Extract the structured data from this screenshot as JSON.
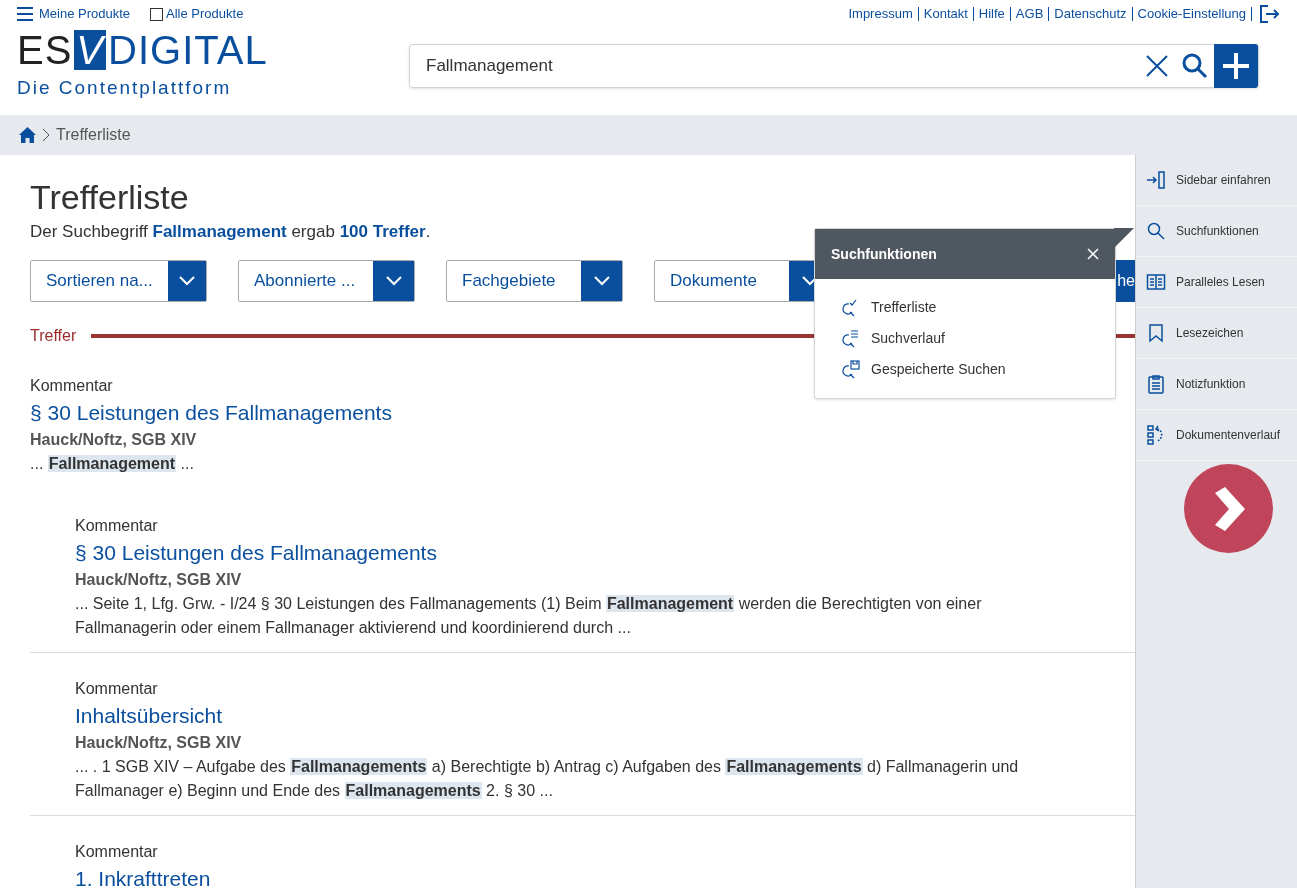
{
  "topbar": {
    "menu_label": "Meine Produkte",
    "all_products": {
      "label": "Alle Produkte",
      "checked": false
    },
    "links": [
      "Impressum",
      "Kontakt",
      "Hilfe",
      "AGB",
      "Datenschutz",
      "Cookie-Einstellung"
    ]
  },
  "logo": {
    "left": "ES",
    "mark": "V",
    "right": "DIGITAL",
    "tagline": "Die Contentplattform"
  },
  "search": {
    "value": "Fallmanagement"
  },
  "breadcrumb": [
    "Trefferliste"
  ],
  "page_title": "Trefferliste",
  "summary": "Der Suchbegriff **Fallmanagement** ergab **100 Treffer**.",
  "filters": [
    "Sortieren na...",
    "Abonnierte ...",
    "Fachgebiete",
    "Dokumente"
  ],
  "hidden_button": "he",
  "section_label": "Treffer",
  "results": [
    {
      "type": "Kommentar",
      "title": "§ 30 Leistungen des Fallmanagements",
      "author": "Hauck/Noftz, SGB XIV",
      "excerpt": "... **Fallmanagement** ...",
      "children": [
        {
          "type": "Kommentar",
          "title": "§ 30 Leistungen des Fallmanagements",
          "author": "Hauck/Noftz, SGB XIV",
          "excerpt": "... Seite 1, Lfg. Grw. - I/24 § 30 Leistungen des Fallmanagements (1) Beim **Fallmanagement** werden die Berechtigten von einer Fallmanagerin oder einem Fallmanager aktivierend und koordinierend durch ..."
        },
        {
          "type": "Kommentar",
          "title": "Inhaltsübersicht",
          "author": "Hauck/Noftz, SGB XIV",
          "excerpt": "... . 1 SGB XIV – Aufgabe des **Fallmanagements** a) Berechtigte b) Antrag c) Aufgaben des **Fallmanagements** d) Fallmanagerin und Fallmanager e) Beginn und Ende des **Fallmanagements** 2. § 30 ..."
        },
        {
          "type": "Kommentar",
          "title": "1. Inkrafttreten"
        }
      ]
    }
  ],
  "popup": {
    "title": "Suchfunktionen",
    "items": [
      {
        "label": "Trefferliste",
        "kind": "check"
      },
      {
        "label": "Suchverlauf",
        "kind": "list"
      },
      {
        "label": "Gespeicherte Suchen",
        "kind": "save"
      }
    ]
  },
  "sidebar": [
    {
      "label": "Sidebar einfahren",
      "kind": "collapse"
    },
    {
      "label": "Suchfunktionen",
      "kind": "search"
    },
    {
      "label": "Paralleles Lesen",
      "kind": "book"
    },
    {
      "label": "Lesezeichen",
      "kind": "bookmark"
    },
    {
      "label": "Notizfunktion",
      "kind": "note"
    },
    {
      "label": "Dokumentenverlauf",
      "kind": "history"
    }
  ]
}
